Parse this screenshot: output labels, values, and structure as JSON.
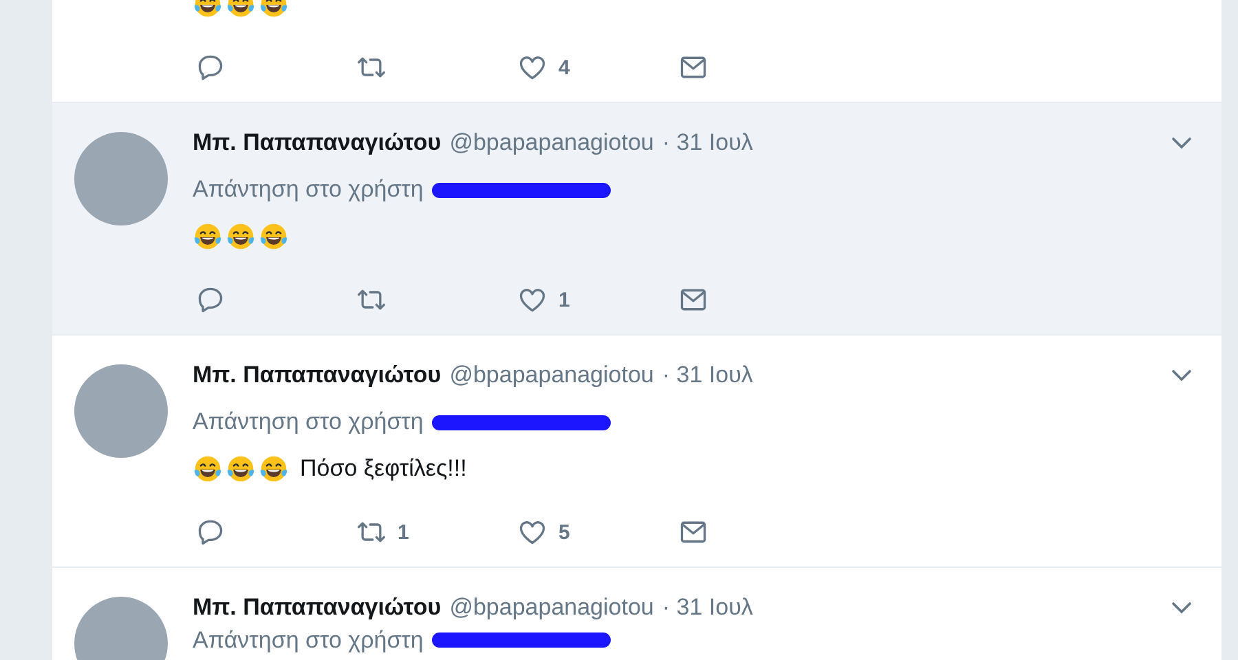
{
  "tweets": [
    {
      "highlighted": false,
      "emojis": [
        {
          "kind": "tears-of-joy"
        },
        {
          "kind": "tears-of-joy"
        },
        {
          "kind": "tears-of-joy"
        }
      ],
      "actions": [
        {
          "kind": "reply"
        },
        {
          "kind": "retweet"
        },
        {
          "kind": "like",
          "count": "4"
        },
        {
          "kind": "message"
        }
      ]
    },
    {
      "highlighted": true,
      "name": "Μπ. Παπαπαναγιώτου",
      "handle": "@bpapapanagiotou",
      "date": "· 31 Ιουλ",
      "reply_to": "Απάντηση στο χρήστη",
      "emojis": [
        {
          "kind": "tears-of-joy"
        },
        {
          "kind": "tears-of-joy"
        },
        {
          "kind": "tears-of-joy"
        }
      ],
      "actions": [
        {
          "kind": "reply"
        },
        {
          "kind": "retweet"
        },
        {
          "kind": "like",
          "count": "1"
        },
        {
          "kind": "message"
        }
      ]
    },
    {
      "highlighted": false,
      "name": "Μπ. Παπαπαναγιώτου",
      "handle": "@bpapapanagiotou",
      "date": "· 31 Ιουλ",
      "reply_to": "Απάντηση στο χρήστη",
      "emojis": [
        {
          "kind": "tears-of-joy"
        },
        {
          "kind": "tears-of-joy"
        },
        {
          "kind": "tears-of-joy"
        }
      ],
      "text": "Πόσο ξεφτίλες!!!",
      "actions": [
        {
          "kind": "reply"
        },
        {
          "kind": "retweet",
          "count": "1"
        },
        {
          "kind": "like",
          "count": "5"
        },
        {
          "kind": "message"
        }
      ]
    },
    {
      "highlighted": false,
      "name": "Μπ. Παπαπαναγιώτου",
      "handle": "@bpapapanagiotou",
      "date": "· 31 Ιουλ",
      "reply_to": "Απάντηση στο χρήστη"
    }
  ]
}
